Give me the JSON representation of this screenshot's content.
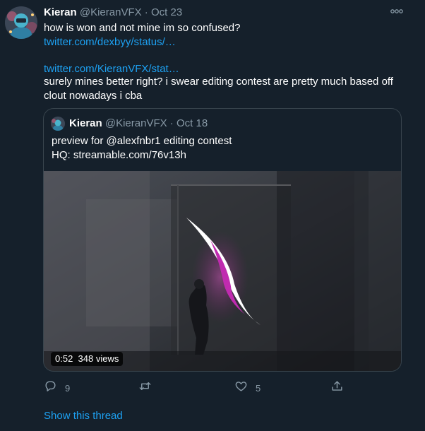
{
  "tweet": {
    "author_name": "Kieran",
    "author_handle": "@KieranVFX",
    "separator": "·",
    "date": "Oct 23",
    "line1": "how is won and not mine im so confused?",
    "link1": "twitter.com/dexbyy/status/…",
    "link2": "twitter.com/KieranVFX/stat…",
    "line2": "surely mines better right? i swear editing contest are pretty much based off",
    "line3": "clout nowadays i cba"
  },
  "quote": {
    "author_name": "Kieran",
    "author_handle": "@KieranVFX",
    "separator": "·",
    "date": "Oct 18",
    "line1": "preview for @alexfnbr1 editing contest",
    "line2": "HQ: streamable.com/76v13h",
    "video_duration": "0:52",
    "video_views": "348 views"
  },
  "actions": {
    "reply_count": "9",
    "like_count": "5",
    "icons": [
      "reply-icon",
      "retweet-icon",
      "like-icon",
      "share-icon"
    ]
  },
  "show_thread": "Show this thread",
  "colors": {
    "background": "#15202b",
    "link": "#1da1f2",
    "secondary_text": "#8899a6",
    "border": "#38444d",
    "slash_accent": "#c02bb0"
  }
}
